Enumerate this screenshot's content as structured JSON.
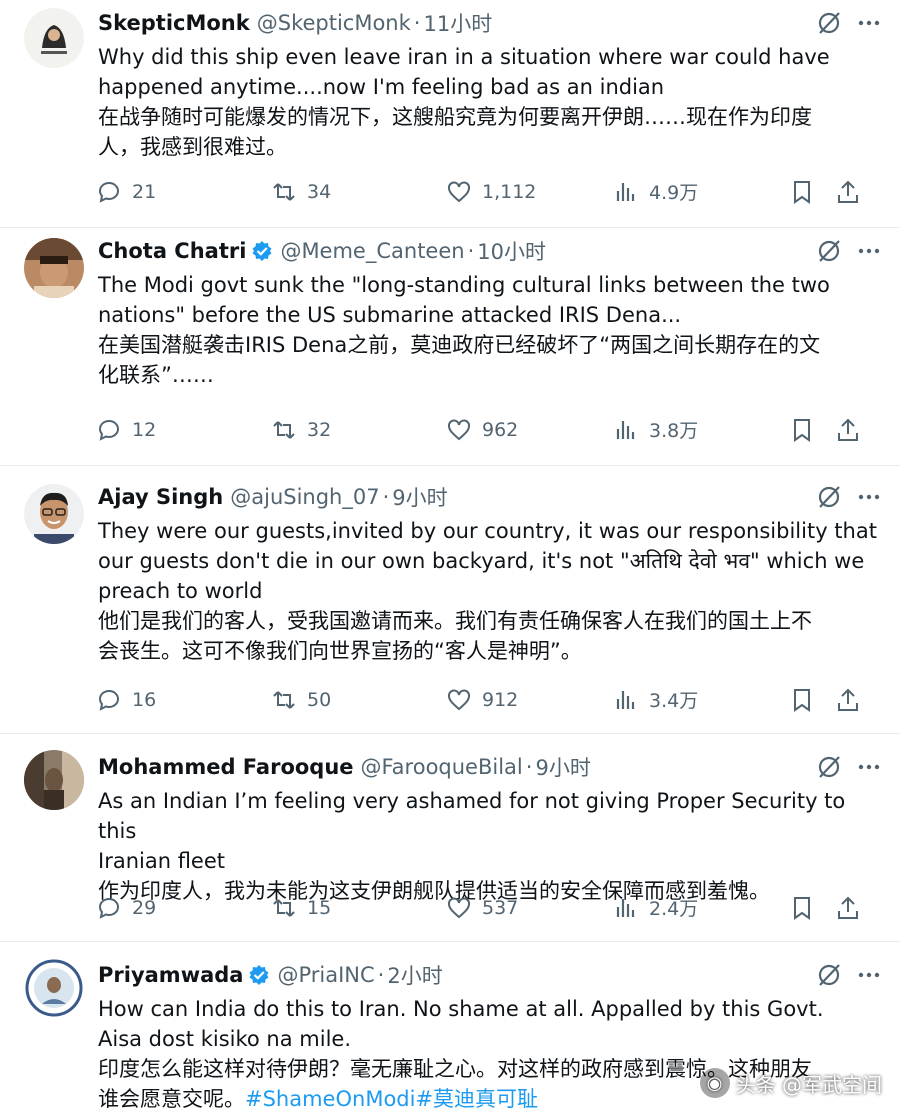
{
  "colors": {
    "accent": "#1d9bf0",
    "text": "#0f1419",
    "muted": "#536471",
    "divider": "#e6ecf0"
  },
  "tweets": [
    {
      "name": "SkepticMonk",
      "verified": false,
      "handle": "@SkepticMonk",
      "time": "11小时",
      "lines": [
        "Why did this ship even leave iran in a situation where war could have",
        "happened anytime....now I'm feeling bad as an indian",
        "在战争随时可能爆发的情况下，这艘船究竟为何要离开伊朗……现在作为印度",
        "人，我感到很难过。"
      ],
      "replies": "21",
      "retweets": "34",
      "likes": "1,112",
      "views": "4.9万"
    },
    {
      "name": "Chota Chatri",
      "verified": true,
      "handle": "@Meme_Canteen",
      "time": "10小时",
      "lines": [
        "The Modi govt sunk the \"long-standing cultural links between the two",
        "nations\" before the US submarine attacked IRIS Dena...",
        "在美国潜艇袭击IRIS Dena之前，莫迪政府已经破坏了“两国之间长期存在的文",
        "化联系”……"
      ],
      "replies": "12",
      "retweets": "32",
      "likes": "962",
      "views": "3.8万"
    },
    {
      "name": "Ajay Singh",
      "verified": false,
      "handle": "@ajuSingh_07",
      "time": "9小时",
      "lines": [
        "They were our guests,invited by our country, it was our responsibility that",
        "our guests don't die in our own backyard, it's not \"अतिथि देवो भव\" which we",
        "preach to world",
        "他们是我们的客人，受我国邀请而来。我们有责任确保客人在我们的国土上不",
        "会丧生。这可不像我们向世界宣扬的“客人是神明”。"
      ],
      "replies": "16",
      "retweets": "50",
      "likes": "912",
      "views": "3.4万"
    },
    {
      "name": "Mohammed Farooque",
      "verified": false,
      "handle": "@FarooqueBilal",
      "time": "9小时",
      "lines": [
        "As an Indian I’m feeling very ashamed for not giving Proper Security to this",
        "Iranian fleet",
        "作为印度人，我为未能为这支伊朗舰队提供适当的安全保障而感到羞愧。"
      ],
      "replies": "29",
      "retweets": "15",
      "likes": "537",
      "views": "2.4万"
    },
    {
      "name": "Priyamwada",
      "verified": true,
      "handle": "@PriaINC",
      "time": "2小时",
      "lines": [
        "How can India do this to Iran. No shame at all. Appalled by this Govt.",
        "Aisa dost kisiko na mile.",
        "印度怎么能这样对待伊朗？毫无廉耻之心。对这样的政府感到震惊。这种朋友",
        "谁会愿意交呢。"
      ],
      "hashtags": "#ShameOnModi#莫迪真可耻"
    }
  ],
  "watermark": {
    "text": "头条 @军武空间"
  }
}
